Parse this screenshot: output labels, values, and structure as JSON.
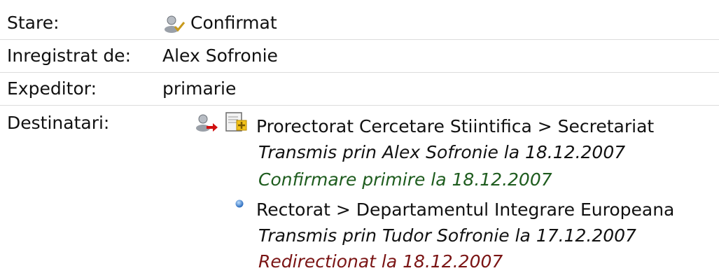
{
  "fields": {
    "stare_label": "Stare:",
    "stare_value": "Confirmat",
    "inregistrat_label": "Inregistrat de:",
    "inregistrat_value": "Alex Sofronie",
    "expeditor_label": "Expeditor:",
    "expeditor_value": "primarie",
    "destinatari_label": "Destinatari:"
  },
  "recipients": [
    {
      "name": "Prorectorat Cercetare Stiintifica > Secretariat",
      "transmis": "Transmis prin Alex Sofronie la 18.12.2007",
      "status": "Confirmare primire la 18.12.2007",
      "status_color": "#1e5c1e"
    },
    {
      "name": "Rectorat > Departamentul Integrare Europeana",
      "transmis": "Transmis prin Tudor Sofronie la 17.12.2007",
      "status": "Redirectionat la 18.12.2007",
      "status_color": "#7a1414"
    }
  ],
  "icons": {
    "status": "user-check-icon",
    "recipient1_user": "user-forward-icon",
    "recipient1_doc": "document-add-icon",
    "recipient2_bullet": "blue-bullet-icon"
  }
}
